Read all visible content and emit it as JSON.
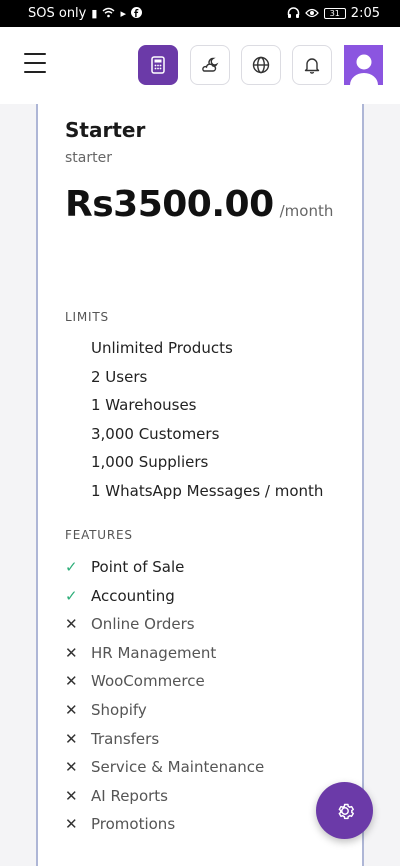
{
  "status_bar": {
    "carrier": "SOS only",
    "battery": "31",
    "time": "2:05",
    "icons": [
      "sim-icon",
      "wifi-icon",
      "data-icon",
      "facebook-icon",
      "headphones-icon",
      "eye-icon",
      "battery-icon"
    ]
  },
  "header": {
    "icons": [
      "menu-icon",
      "calculator-icon",
      "weather-icon",
      "globe-icon",
      "bell-icon",
      "user-icon"
    ],
    "active_button": "calculator",
    "accent_color": "#6b3aa8"
  },
  "plan": {
    "name": "Starter",
    "slug": "starter",
    "price": "Rs3500.00",
    "period": "/month"
  },
  "limits": {
    "title": "LIMITS",
    "items": [
      "Unlimited Products",
      "2 Users",
      "1 Warehouses",
      "3,000 Customers",
      "1,000 Suppliers",
      "1 WhatsApp Messages / month"
    ]
  },
  "features": {
    "title": "FEATURES",
    "items": [
      {
        "label": "Point of Sale",
        "enabled": true,
        "mark": "✓"
      },
      {
        "label": "Accounting",
        "enabled": true,
        "mark": "✓"
      },
      {
        "label": "Online Orders",
        "enabled": false,
        "mark": "✕"
      },
      {
        "label": "HR Management",
        "enabled": false,
        "mark": "✕"
      },
      {
        "label": "WooCommerce",
        "enabled": false,
        "mark": "✕"
      },
      {
        "label": "Shopify",
        "enabled": false,
        "mark": "✕"
      },
      {
        "label": "Transfers",
        "enabled": false,
        "mark": "✕"
      },
      {
        "label": "Service & Maintenance",
        "enabled": false,
        "mark": "✕"
      },
      {
        "label": "AI Reports",
        "enabled": false,
        "mark": "✕"
      },
      {
        "label": "Promotions",
        "enabled": false,
        "mark": "✕"
      }
    ]
  },
  "colors": {
    "check": "#2fae7a",
    "card_border": "#aeb6d6",
    "avatar": "#8b55e0"
  },
  "fab": {
    "icon": "gear-icon"
  }
}
